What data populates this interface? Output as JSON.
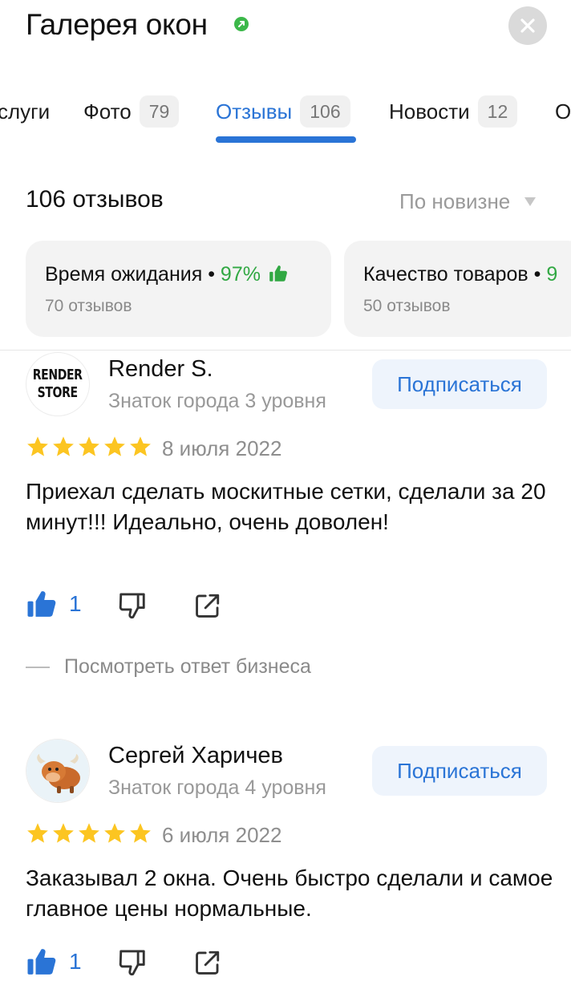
{
  "header": {
    "title": "Галерея окон",
    "close_icon": "close-icon",
    "verified_icon": "verified-check-icon"
  },
  "tabs": [
    {
      "label": "слуги",
      "count": ""
    },
    {
      "label": "Фото",
      "count": "79"
    },
    {
      "label": "Отзывы",
      "count": "106",
      "active": true
    },
    {
      "label": "Новости",
      "count": "12"
    },
    {
      "label": "О",
      "count": ""
    }
  ],
  "colors": {
    "accent": "#2a74d6",
    "positive": "#31a843",
    "star": "#fcc521"
  },
  "reviews_header": {
    "count_title": "106 отзывов",
    "sort_label": "По новизне"
  },
  "aspects": [
    {
      "name": "Время ожидания",
      "percent": "97%",
      "reviews": "70 отзывов"
    },
    {
      "name": "Качество товаров",
      "percent": "9",
      "reviews": "50 отзывов"
    }
  ],
  "reviews": [
    {
      "author": "Render S.",
      "avatar_text": "RENDER\nSTORE",
      "level": "Знаток города 3 уровня",
      "subscribe_label": "Подписаться",
      "rating": 5,
      "date": "8 июля 2022",
      "text": "Приехал сделать москитные сетки, сделали за 20 минут!!! Идеально, очень доволен!",
      "likes": "1",
      "business_reply_label": "Посмотреть ответ бизнеса"
    },
    {
      "author": "Сергей Харичев",
      "avatar_icon": "bull-avatar-icon",
      "level": "Знаток города 4 уровня",
      "subscribe_label": "Подписаться",
      "rating": 5,
      "date": "6 июля 2022",
      "text": "Заказывал 2 окна. Очень быстро сделали и самое главное цены нормальные.",
      "likes": "1"
    }
  ]
}
